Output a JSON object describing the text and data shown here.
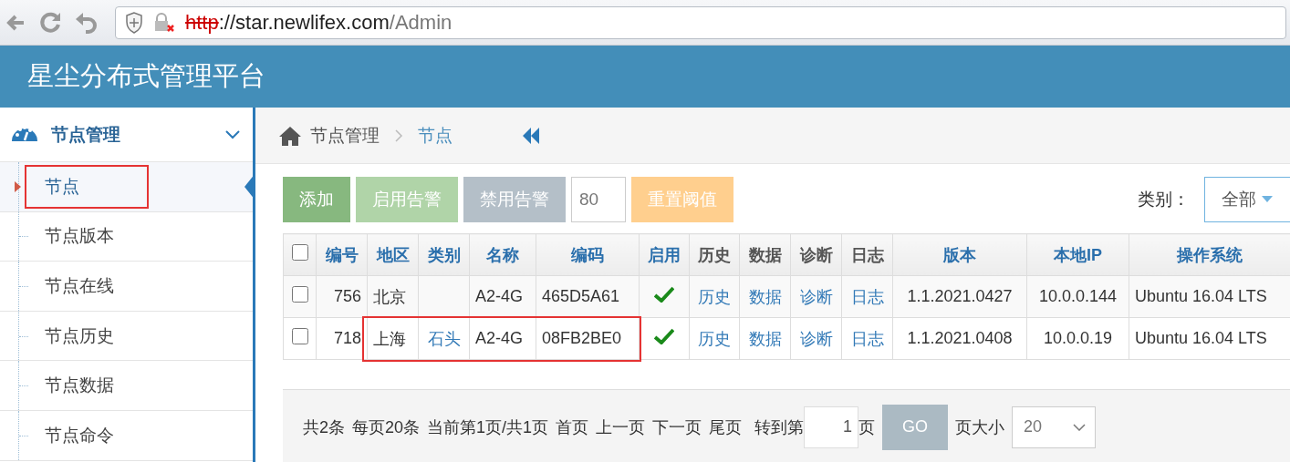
{
  "browser": {
    "url_scheme": "http",
    "url_host": "://star.newlifex.com",
    "url_path": "/Admin"
  },
  "header": {
    "title": "星尘分布式管理平台"
  },
  "sidebar": {
    "group": {
      "label": "节点管理",
      "expanded": true
    },
    "items": [
      {
        "label": "节点",
        "selected": true,
        "annotated": true
      },
      {
        "label": "节点版本",
        "selected": false,
        "annotated": false
      },
      {
        "label": "节点在线",
        "selected": false,
        "annotated": false
      },
      {
        "label": "节点历史",
        "selected": false,
        "annotated": false
      },
      {
        "label": "节点数据",
        "selected": false,
        "annotated": false
      },
      {
        "label": "节点命令",
        "selected": false,
        "annotated": false
      }
    ]
  },
  "breadcrumb": [
    "节点管理",
    "节点"
  ],
  "toolbar": [
    {
      "kind": "button",
      "label": "添加",
      "color": "#87b87f"
    },
    {
      "kind": "button",
      "label": "启用告警",
      "color": "#b0d4a8"
    },
    {
      "kind": "button",
      "label": "禁用告警",
      "color": "#b4bfc8"
    },
    {
      "kind": "input",
      "value": "80"
    },
    {
      "kind": "button",
      "label": "重置阈值",
      "color": "#ffcf8e"
    }
  ],
  "filter": {
    "label": "类别：",
    "value": "全部"
  },
  "table": {
    "all_checked": false,
    "columns": [
      {
        "label": "编号",
        "sortable": true
      },
      {
        "label": "地区",
        "sortable": true
      },
      {
        "label": "类别",
        "sortable": true
      },
      {
        "label": "名称",
        "sortable": true
      },
      {
        "label": "编码",
        "sortable": true
      },
      {
        "label": "启用",
        "sortable": true
      },
      {
        "label": "历史",
        "sortable": false
      },
      {
        "label": "数据",
        "sortable": false
      },
      {
        "label": "诊断",
        "sortable": false
      },
      {
        "label": "日志",
        "sortable": false
      },
      {
        "label": "版本",
        "sortable": true
      },
      {
        "label": "本地IP",
        "sortable": true
      },
      {
        "label": "操作系统",
        "sortable": true
      }
    ],
    "rows": [
      {
        "checked": false,
        "cells": [
          {
            "kind": "number",
            "text": "756",
            "annotated": false
          },
          {
            "kind": "text",
            "text": "北京",
            "annotated": false
          },
          {
            "kind": "empty",
            "annotated": false
          },
          {
            "kind": "text",
            "text": "A2-4G",
            "annotated": false
          },
          {
            "kind": "text",
            "text": "465D5A61",
            "annotated": false
          },
          {
            "kind": "check",
            "on": true,
            "annotated": false
          },
          {
            "kind": "link",
            "text": "历史",
            "annotated": false
          },
          {
            "kind": "link",
            "text": "数据",
            "annotated": false
          },
          {
            "kind": "link",
            "text": "诊断",
            "annotated": false
          },
          {
            "kind": "link",
            "text": "日志",
            "annotated": false
          },
          {
            "kind": "centered",
            "text": "1.1.2021.0427",
            "annotated": false
          },
          {
            "kind": "centered",
            "text": "10.0.0.144",
            "annotated": false
          },
          {
            "kind": "text",
            "text": "Ubuntu 16.04 LTS",
            "annotated": false
          }
        ]
      },
      {
        "checked": false,
        "cells": [
          {
            "kind": "number",
            "text": "718",
            "annotated": false
          },
          {
            "kind": "text",
            "text": "上海",
            "annotated": true
          },
          {
            "kind": "link",
            "text": "石头",
            "annotated": true
          },
          {
            "kind": "text",
            "text": "A2-4G",
            "annotated": true
          },
          {
            "kind": "text",
            "text": "08FB2BE0",
            "annotated": true
          },
          {
            "kind": "check",
            "on": true,
            "annotated": false
          },
          {
            "kind": "link",
            "text": "历史",
            "annotated": false
          },
          {
            "kind": "link",
            "text": "数据",
            "annotated": false
          },
          {
            "kind": "link",
            "text": "诊断",
            "annotated": false
          },
          {
            "kind": "link",
            "text": "日志",
            "annotated": false
          },
          {
            "kind": "centered",
            "text": "1.1.2021.0408",
            "annotated": false
          },
          {
            "kind": "centered",
            "text": "10.0.0.19",
            "annotated": false
          },
          {
            "kind": "text",
            "text": "Ubuntu 16.04 LTS",
            "annotated": false
          }
        ]
      }
    ]
  },
  "pager": {
    "items": [
      "共2条",
      "每页20条",
      "当前第1页/共1页"
    ],
    "links": [
      "首页",
      "上一页",
      "下一页",
      "尾页"
    ],
    "goto_before": "转到第",
    "page": "1",
    "goto_after": "页",
    "go": "GO",
    "size_label": "页大小",
    "size": "20"
  }
}
